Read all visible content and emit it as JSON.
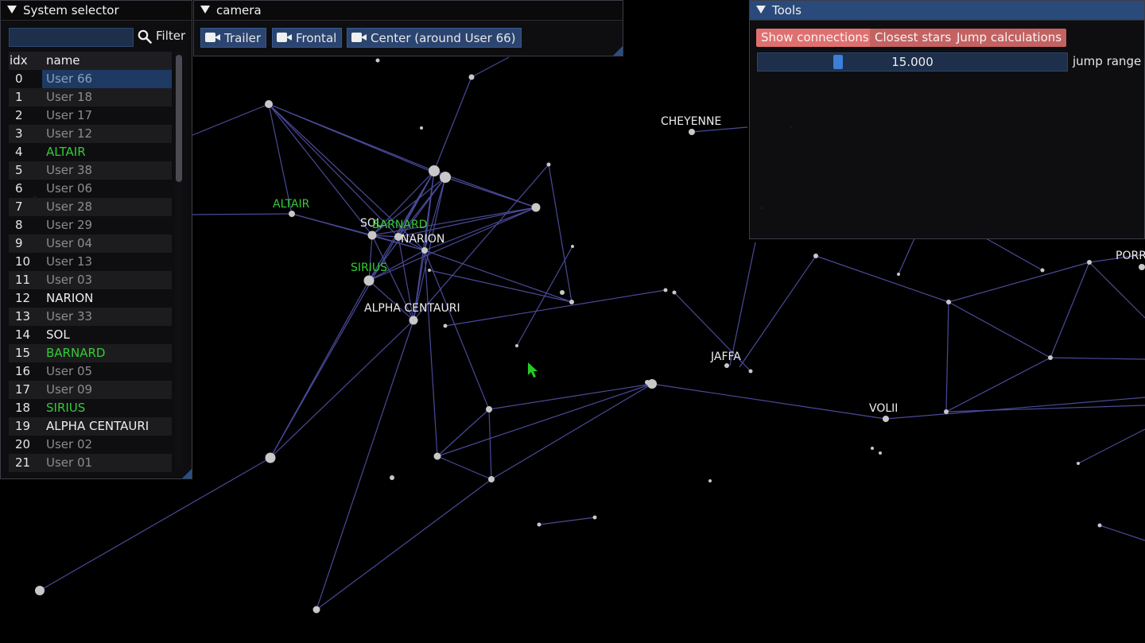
{
  "colors": {
    "green_star": "#33cc33",
    "white_star": "#e6e6e6",
    "edge": "#4a4a9a",
    "active_title": "#294a7a",
    "button_blue": "#2b4570",
    "tool_button": "#c46262"
  },
  "system_selector": {
    "title": "System selector",
    "filter_value": "",
    "filter_label": "Filter",
    "columns": [
      "idx",
      "name"
    ],
    "rows": [
      {
        "idx": "0",
        "name": "User 66",
        "color": "#8aa0b8",
        "selected": true
      },
      {
        "idx": "1",
        "name": "User 18",
        "color": "#8c8c8c"
      },
      {
        "idx": "2",
        "name": "User 17",
        "color": "#8c8c8c"
      },
      {
        "idx": "3",
        "name": "User 12",
        "color": "#8c8c8c"
      },
      {
        "idx": "4",
        "name": "ALTAIR",
        "color": "#33cc33"
      },
      {
        "idx": "5",
        "name": "User 38",
        "color": "#8c8c8c"
      },
      {
        "idx": "6",
        "name": "User 06",
        "color": "#8c8c8c"
      },
      {
        "idx": "7",
        "name": "User 28",
        "color": "#8c8c8c"
      },
      {
        "idx": "8",
        "name": "User 29",
        "color": "#8c8c8c"
      },
      {
        "idx": "9",
        "name": "User 04",
        "color": "#8c8c8c"
      },
      {
        "idx": "10",
        "name": "User 13",
        "color": "#8c8c8c"
      },
      {
        "idx": "11",
        "name": "User 03",
        "color": "#8c8c8c"
      },
      {
        "idx": "12",
        "name": "NARION",
        "color": "#eeeeee"
      },
      {
        "idx": "13",
        "name": "User 33",
        "color": "#8c8c8c"
      },
      {
        "idx": "14",
        "name": "SOL",
        "color": "#eeeeee"
      },
      {
        "idx": "15",
        "name": "BARNARD",
        "color": "#33cc33"
      },
      {
        "idx": "16",
        "name": "User 05",
        "color": "#8c8c8c"
      },
      {
        "idx": "17",
        "name": "User 09",
        "color": "#8c8c8c"
      },
      {
        "idx": "18",
        "name": "SIRIUS",
        "color": "#33cc33"
      },
      {
        "idx": "19",
        "name": "ALPHA CENTAURI",
        "color": "#eeeeee"
      },
      {
        "idx": "20",
        "name": "User 02",
        "color": "#8c8c8c"
      },
      {
        "idx": "21",
        "name": "User 01",
        "color": "#8c8c8c"
      }
    ]
  },
  "camera": {
    "title": "camera",
    "buttons": [
      "Trailer",
      "Frontal",
      "Center (around User 66)"
    ]
  },
  "tools": {
    "title": "Tools",
    "buttons": [
      "Show connections",
      "Closest stars",
      "Jump calculations"
    ],
    "active_button": "Show connections",
    "jump_range_value": "15.000",
    "jump_range_label": "jump range"
  },
  "map_labels": {
    "altair": "ALTAIR",
    "sol": "SOL",
    "barnard": "BARNARD",
    "narion": "NARION",
    "sirius": "SIRIUS",
    "alpha_centauri": "ALPHA CENTAURI",
    "cheyenne": "CHEYENNE",
    "jaffa": "JAFFA",
    "volii": "VOLII",
    "porr": "PORR"
  }
}
